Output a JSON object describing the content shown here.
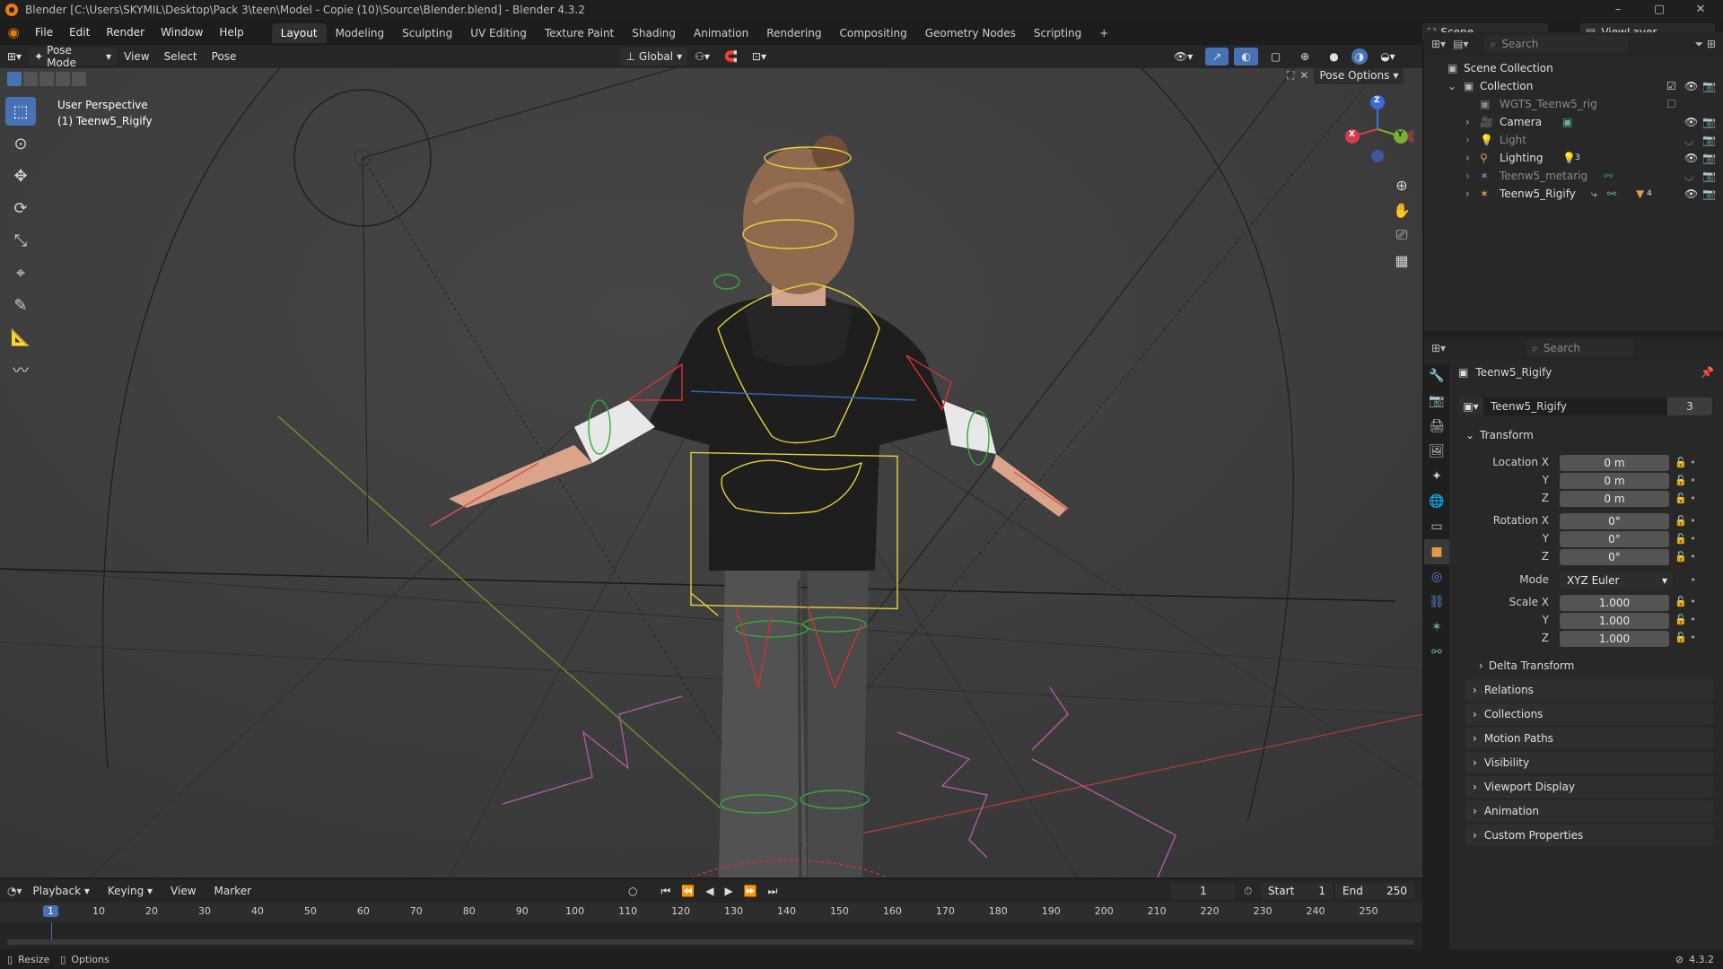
{
  "window": {
    "title": "Blender [C:\\Users\\SKYMIL\\Desktop\\Pack 3\\teen\\Model - Copie (10)\\Source\\Blender.blend] - Blender 4.3.2",
    "btn_min": "–",
    "btn_max": "▢",
    "btn_close": "✕"
  },
  "menu": {
    "items": [
      "File",
      "Edit",
      "Render",
      "Window",
      "Help"
    ]
  },
  "workspaces": {
    "tabs": [
      "Layout",
      "Modeling",
      "Sculpting",
      "UV Editing",
      "Texture Paint",
      "Shading",
      "Animation",
      "Rendering",
      "Compositing",
      "Geometry Nodes",
      "Scripting"
    ],
    "active": "Layout",
    "add": "+"
  },
  "scene": {
    "name": "Scene",
    "view_layer": "ViewLayer"
  },
  "header3d": {
    "mode": "Pose Mode",
    "view": "View",
    "select": "Select",
    "pose": "Pose",
    "orientation": "Global",
    "pose_options": "Pose Options"
  },
  "viewport": {
    "perspective": "User Perspective",
    "object": "(1) Teenw5_Rigify",
    "gizmo": {
      "x": "X",
      "y": "Y",
      "z": "Z"
    }
  },
  "outliner": {
    "search_placeholder": "Search",
    "scene_collection": "Scene Collection",
    "collection": "Collection",
    "items": [
      {
        "name": "WGTS_Teenw5_rig",
        "dim": true
      },
      {
        "name": "Camera",
        "dim": false
      },
      {
        "name": "Light",
        "dim": true
      },
      {
        "name": "Lighting",
        "dim": false,
        "badge": "3"
      },
      {
        "name": "Teenw5_metarig",
        "dim": true
      },
      {
        "name": "Teenw5_Rigify",
        "dim": false,
        "badge": "4"
      }
    ]
  },
  "properties": {
    "search_placeholder": "Search",
    "object_name": "Teenw5_Rigify",
    "datablock": "Teenw5_Rigify",
    "users": "3",
    "transform_label": "Transform",
    "location": {
      "label": "Location X",
      "x": "0 m",
      "y": "0 m",
      "z": "0 m"
    },
    "rotation": {
      "label": "Rotation X",
      "x": "0°",
      "y": "0°",
      "z": "0°"
    },
    "mode": {
      "label": "Mode",
      "value": "XYZ Euler"
    },
    "scale": {
      "label": "Scale X",
      "x": "1.000",
      "y": "1.000",
      "z": "1.000"
    },
    "axis_labels": {
      "y": "Y",
      "z": "Z"
    },
    "delta": "Delta Transform",
    "panels": [
      "Relations",
      "Collections",
      "Motion Paths",
      "Visibility",
      "Viewport Display",
      "Animation",
      "Custom Properties"
    ]
  },
  "timeline": {
    "playback": "Playback",
    "keying": "Keying",
    "view": "View",
    "marker": "Marker",
    "current_frame": "1",
    "start_label": "Start",
    "start": "1",
    "end_label": "End",
    "end": "250",
    "ticks": [
      "1",
      "10",
      "20",
      "30",
      "40",
      "50",
      "60",
      "70",
      "80",
      "90",
      "100",
      "110",
      "120",
      "130",
      "140",
      "150",
      "160",
      "170",
      "180",
      "190",
      "200",
      "210",
      "220",
      "230",
      "240",
      "250"
    ]
  },
  "status": {
    "resize": "Resize",
    "options": "Options",
    "version": "4.3.2"
  },
  "colors": {
    "accent": "#4772b3",
    "bone_selected": "#e8d23c",
    "bone_red": "#d23232",
    "bone_green": "#38a838",
    "ground_x": "#b33a3a",
    "ground_y": "#6c9a2a"
  }
}
